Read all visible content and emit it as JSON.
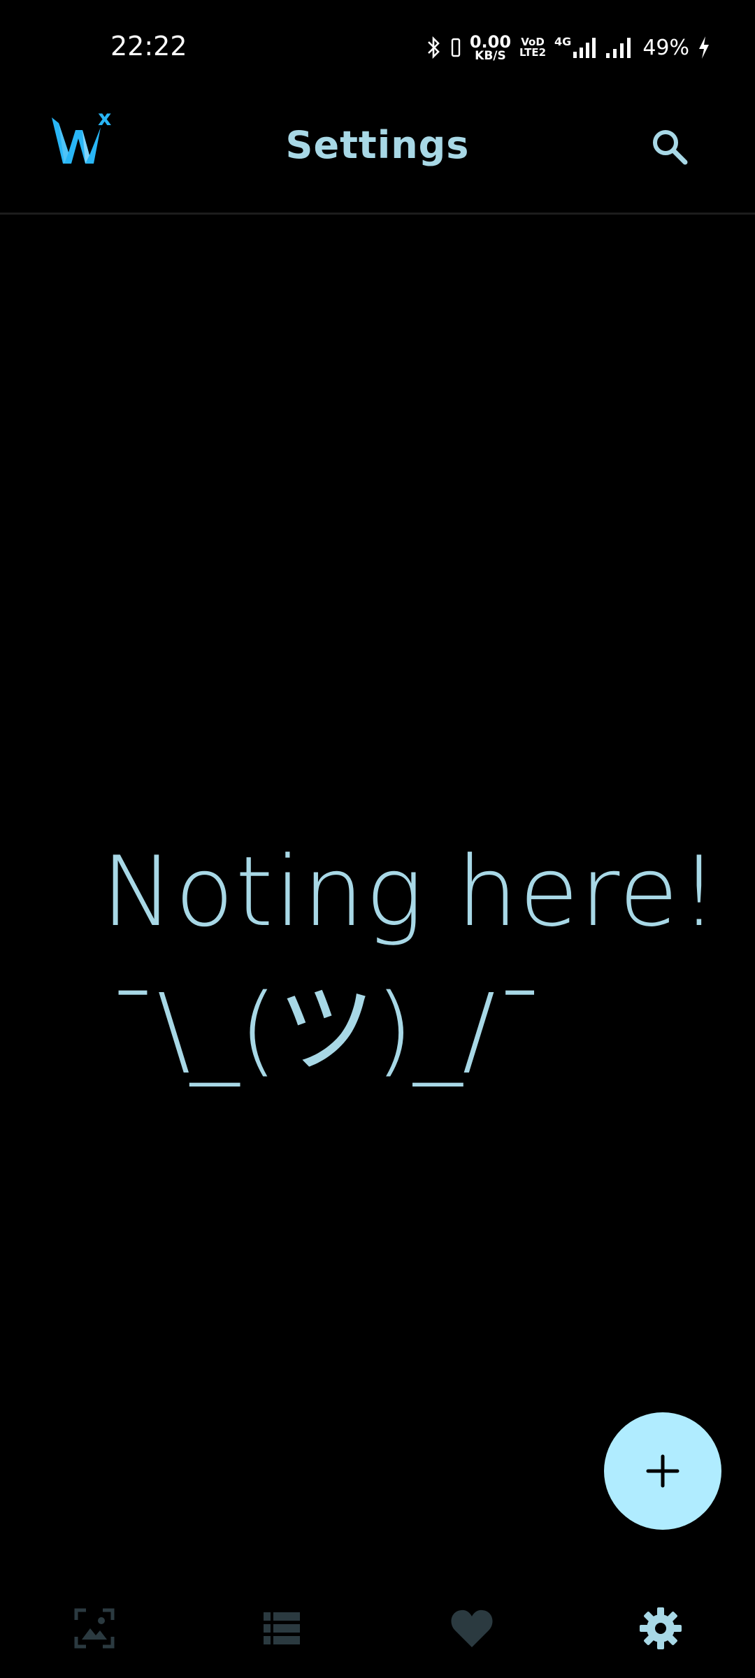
{
  "status_bar": {
    "time": "22:22",
    "net_speed_value": "0.00",
    "net_speed_unit": "KB/S",
    "volte_top": "VoD",
    "volte_bottom": "LTE2",
    "network_type": "4G",
    "battery": "49%"
  },
  "app_bar": {
    "title": "Settings",
    "logo_superscript": "x",
    "logo_icon": "wx-logo-icon",
    "search_icon": "search-icon"
  },
  "empty_state": {
    "title": "Noting here!",
    "shrug": "¯\\_(ツ)_/¯"
  },
  "fab": {
    "icon": "plus-icon"
  },
  "bottom_nav": {
    "items": [
      {
        "id": "wallpapers",
        "icon": "image-frame-icon",
        "active": false
      },
      {
        "id": "list",
        "icon": "list-icon",
        "active": false
      },
      {
        "id": "favorites",
        "icon": "heart-icon",
        "active": false
      },
      {
        "id": "settings",
        "icon": "gear-icon",
        "active": true
      }
    ]
  },
  "colors": {
    "background": "#000000",
    "accent": "#a8d8e6",
    "fab": "#b0ecff",
    "logo_blue": "#29b6f6",
    "nav_inactive": "#2b3a40",
    "nav_active": "#a8d8e6",
    "divider": "#1c1c1c"
  }
}
